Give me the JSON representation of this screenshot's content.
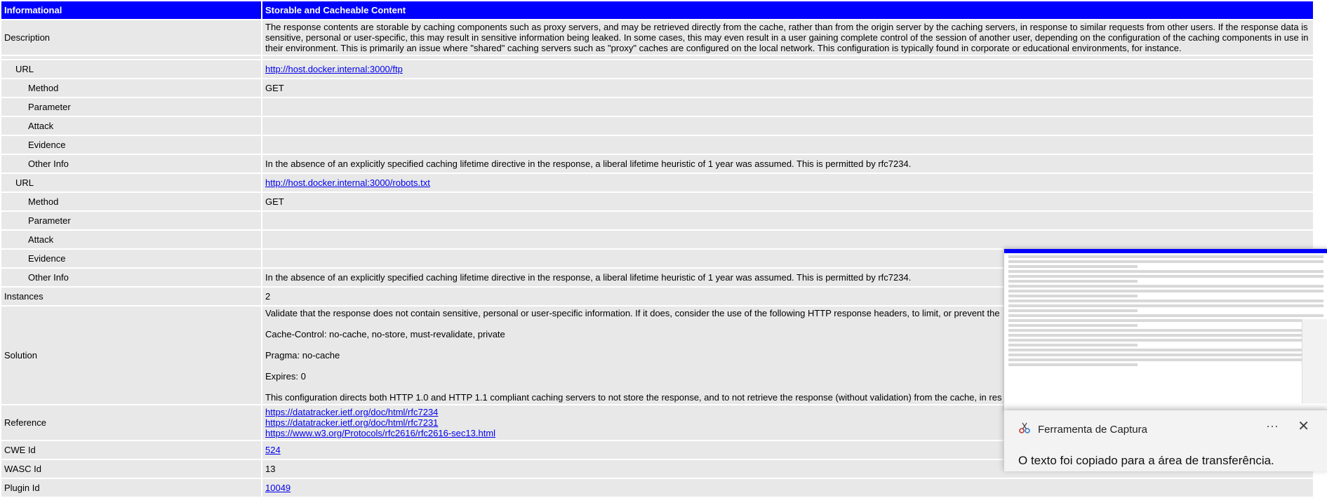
{
  "header": {
    "risk": "Informational",
    "name": "Storable and Cacheable Content"
  },
  "description": {
    "label": "Description",
    "text": "The response contents are storable by caching components such as proxy servers, and may be retrieved directly from the cache, rather than from the origin server by the caching servers, in response to similar requests from other users. If the response data is sensitive, personal or user-specific, this may result in sensitive information being leaked. In some cases, this may even result in a user gaining complete control of the session of another user, depending on the configuration of the caching components in use in their environment. This is primarily an issue where \"shared\" caching servers such as \"proxy\" caches are configured on the local network. This configuration is typically found in corporate or educational environments, for instance."
  },
  "labels": {
    "url": "URL",
    "method": "Method",
    "parameter": "Parameter",
    "attack": "Attack",
    "evidence": "Evidence",
    "other_info": "Other Info",
    "instances": "Instances",
    "solution": "Solution",
    "reference": "Reference",
    "cwe": "CWE Id",
    "wasc": "WASC Id",
    "plugin": "Plugin Id"
  },
  "instances": [
    {
      "url": "http://host.docker.internal:3000/ftp",
      "method": "GET",
      "parameter": "",
      "attack": "",
      "evidence": "",
      "other_info": "In the absence of an explicitly specified caching lifetime directive in the response, a liberal lifetime heuristic of 1 year was assumed. This is permitted by rfc7234."
    },
    {
      "url": "http://host.docker.internal:3000/robots.txt",
      "method": "GET",
      "parameter": "",
      "attack": "",
      "evidence": "",
      "other_info": "In the absence of an explicitly specified caching lifetime directive in the response, a liberal lifetime heuristic of 1 year was assumed. This is permitted by rfc7234."
    }
  ],
  "instances_count": "2",
  "solution": [
    "Validate that the response does not contain sensitive, personal or user-specific information. If it does, consider the use of the following HTTP response headers, to limit, or prevent the",
    "Cache-Control: no-cache, no-store, must-revalidate, private",
    "Pragma: no-cache",
    "Expires: 0",
    "This configuration directs both HTTP 1.0 and HTTP 1.1 compliant caching servers to not store the response, and to not retrieve the response (without validation) from the cache, in res"
  ],
  "references": [
    "https://datatracker.ietf.org/doc/html/rfc7234",
    "https://datatracker.ietf.org/doc/html/rfc7231",
    "https://www.w3.org/Protocols/rfc2616/rfc2616-sec13.html"
  ],
  "cwe_id": "524",
  "wasc_id": "13",
  "plugin_id": "10049",
  "toast": {
    "app_name": "Ferramenta de Captura",
    "more": "···",
    "close": "✕",
    "message": "O texto foi copiado para a área de transferência."
  },
  "colors": {
    "header_bg": "#0000ff",
    "cell_bg": "#e8e8e8",
    "link": "#0000ee"
  }
}
